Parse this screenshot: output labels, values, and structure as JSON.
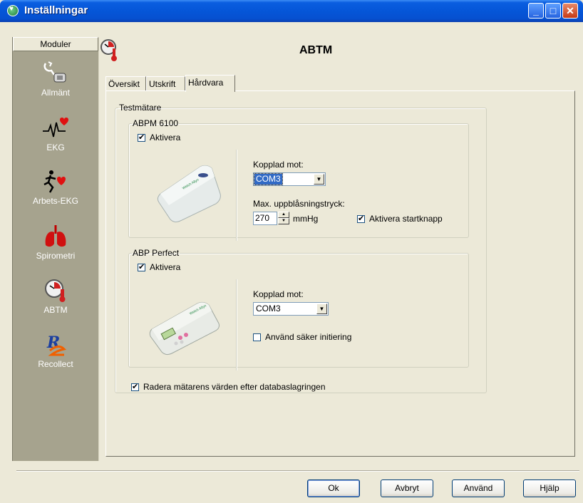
{
  "window": {
    "title": "Inställningar"
  },
  "sidebar": {
    "header": "Moduler",
    "items": [
      {
        "label": "Allmänt",
        "icon": "phone-plug-icon"
      },
      {
        "label": "EKG",
        "icon": "ecg-heart-icon"
      },
      {
        "label": "Arbets-EKG",
        "icon": "running-man-heart-icon"
      },
      {
        "label": "Spirometri",
        "icon": "lungs-icon"
      },
      {
        "label": "ABTM",
        "icon": "clock-thermometer-icon"
      },
      {
        "label": "Recollect",
        "icon": "recollect-logo-icon"
      }
    ]
  },
  "page": {
    "title": "ABTM"
  },
  "tabs": [
    {
      "label": "Översikt",
      "active": false
    },
    {
      "label": "Utskrift",
      "active": false
    },
    {
      "label": "Hårdvara",
      "active": true
    }
  ],
  "testmatare": {
    "legend": "Testmätare",
    "abpm": {
      "legend": "ABPM 6100",
      "activate_label": "Aktivera",
      "activate_checked": true,
      "connected_label": "Kopplad mot:",
      "connected_value": "COM3",
      "pressure_label": "Max. uppblåsningstryck:",
      "pressure_value": "270",
      "pressure_unit": "mmHg",
      "startbutton_label": "Aktivera startknapp",
      "startbutton_checked": true
    },
    "abp": {
      "legend": "ABP Perfect",
      "activate_label": "Aktivera",
      "activate_checked": true,
      "connected_label": "Kopplad mot:",
      "connected_value": "COM3",
      "safe_init_label": "Använd säker initiering",
      "safe_init_checked": false
    },
    "delete_label": "Radera mätarens värden efter databaslagringen",
    "delete_checked": true
  },
  "buttons": {
    "ok": "Ok",
    "cancel": "Avbryt",
    "apply": "Använd",
    "help": "Hjälp"
  },
  "colors": {
    "title_bar": "#0556d8",
    "sidebar": "#a6a38e",
    "dialog": "#ece9d8",
    "selection": "#316ac5"
  }
}
